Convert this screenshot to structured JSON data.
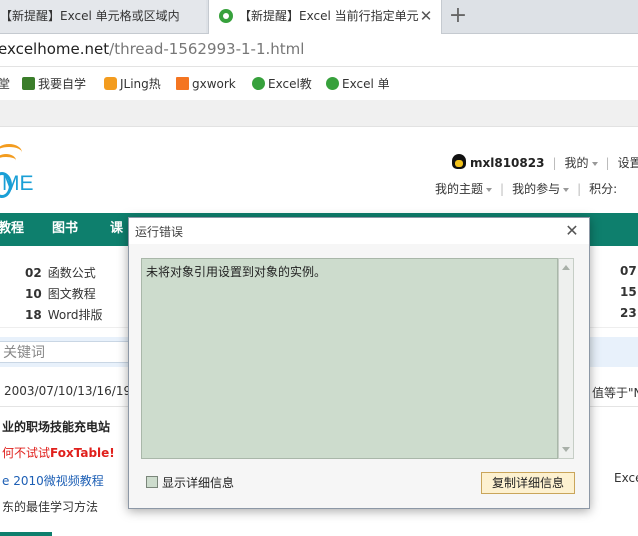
{
  "browser": {
    "tabs": [
      {
        "title": "【新提醒】Excel 单元格或区域内",
        "active": false
      },
      {
        "title": "【新提醒】Excel 当前行指定单元",
        "active": true
      }
    ],
    "new_tab_symbol": "+",
    "url": {
      "host": "excelhome.net",
      "path": "/thread-1562993-1-1.html"
    },
    "bookmarks": [
      {
        "label": "堂",
        "icon": "folder-icon"
      },
      {
        "label": "我要自学",
        "icon": "bookmark-icon"
      },
      {
        "label": "JLing热",
        "icon": "bookmark-icon"
      },
      {
        "label": "gxwork",
        "icon": "bookmark-icon"
      },
      {
        "label": "Excel教",
        "icon": "globe-icon"
      },
      {
        "label": "Excel 单",
        "icon": "globe-icon"
      }
    ]
  },
  "site": {
    "logo_text": "ME",
    "user": {
      "name": "mxl810823",
      "menu_mine": "我的",
      "settings": "设置"
    },
    "subnav": {
      "topics": "我的主题",
      "participation": "我的参与",
      "points": "积分:"
    },
    "nav": [
      "教程",
      "图书",
      "课"
    ],
    "categories_left": [
      {
        "num": "02",
        "label": "函数公式"
      },
      {
        "num": "10",
        "label": "图文教程"
      },
      {
        "num": "18",
        "label": "Word排版"
      }
    ],
    "categories_right": [
      "07",
      "15",
      "23"
    ],
    "search_placeholder": "关键词",
    "dates": "2003/07/10/13/16/19",
    "right_note": "值等于\"N",
    "promos": [
      "业的职场技能充电站",
      "何不试试",
      "FoxTable!",
      "e 2010微视频教程",
      "东的最佳学习方法"
    ],
    "excel_right": "Excel"
  },
  "dialog": {
    "title": "运行错误",
    "close_symbol": "✕",
    "message": "未将对象引用设置到对象的实例。",
    "checkbox_label": "显示详细信息",
    "checkbox_checked": false,
    "copy_button": "复制详细信息"
  },
  "colors": {
    "nav_green": "#0e7f6d",
    "message_bg": "#cddccd",
    "copy_button_bg": "#fdf1d0",
    "promo_red": "#e0201c",
    "link_blue": "#1d5fb5"
  }
}
